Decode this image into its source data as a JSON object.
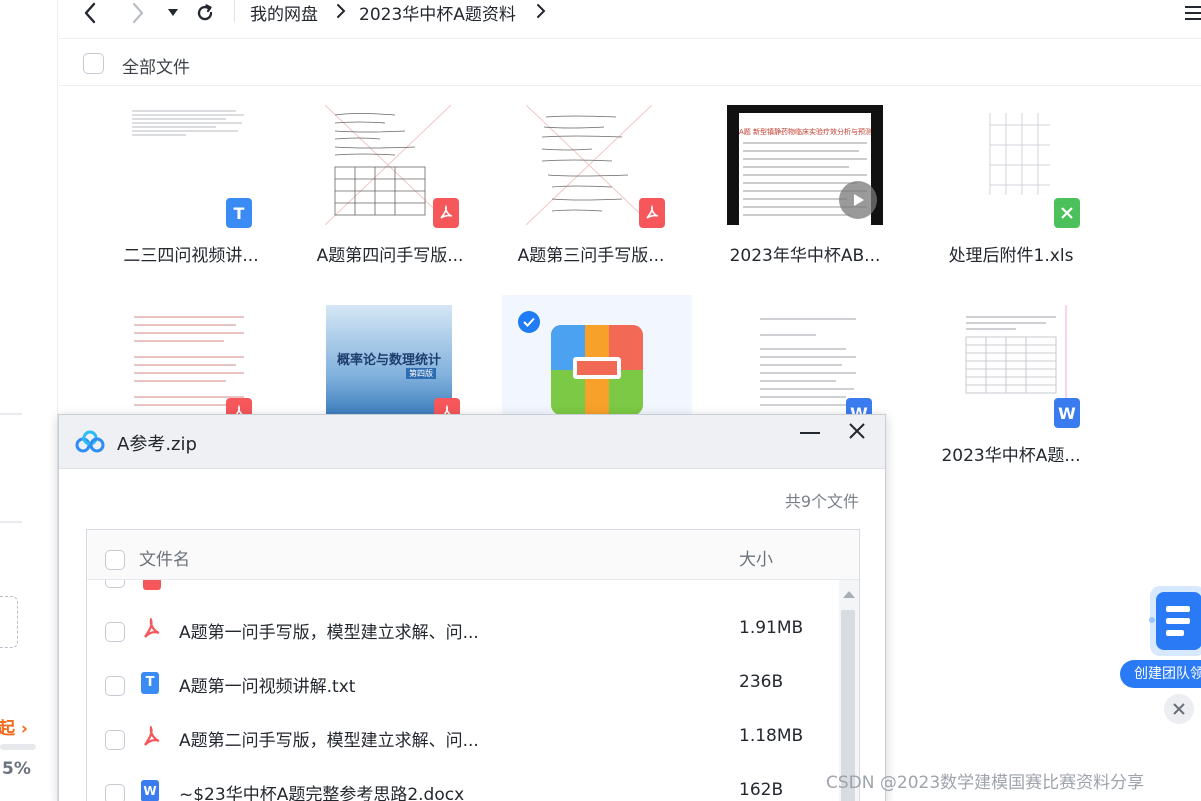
{
  "nav": {
    "crumbs": [
      "我的网盘",
      "2023华中杯A题资料"
    ]
  },
  "toolbar": {
    "all_files": "全部文件"
  },
  "grid": {
    "row1": [
      {
        "name": "二三四问视频讲...",
        "badge": "T"
      },
      {
        "name": "A题第四问手写版...",
        "badge": "pdf"
      },
      {
        "name": "A题第三问手写版...",
        "badge": "pdf"
      },
      {
        "name": "2023年华中杯AB...",
        "badge": "video",
        "thumb_title": "A题 新型镇静药物临床实验疗效分析与预测"
      },
      {
        "name": "处理后附件1.xls",
        "badge": "X"
      }
    ],
    "row2": [
      {
        "name": "",
        "badge": "pdf"
      },
      {
        "name": "",
        "badge": "pdf",
        "thumb_title": "概率论与数理统计",
        "thumb_sub": "第四版"
      },
      {
        "name": "",
        "badge": "zip",
        "selected": true
      },
      {
        "name": "",
        "badge": "W"
      },
      {
        "name": "2023华中杯A题...",
        "badge": "W"
      }
    ]
  },
  "sidebar": {
    "up_label": "起",
    "pct_label": "5%"
  },
  "modal": {
    "title": "A参考.zip",
    "count": "共9个文件",
    "col_name": "文件名",
    "col_size": "大小",
    "rows": [
      {
        "name": "A题第一问手写版，模型建立求解、问...",
        "size": "1.91MB",
        "type": "pdf"
      },
      {
        "name": "A题第一问视频讲解.txt",
        "size": "236B",
        "type": "txt"
      },
      {
        "name": "A题第二问手写版，模型建立求解、问...",
        "size": "1.18MB",
        "type": "pdf"
      },
      {
        "name": "~$23华中杯A题完整参考思路2.docx",
        "size": "162B",
        "type": "doc"
      }
    ]
  },
  "promo": {
    "label": "创建团队领福"
  },
  "watermark": "CSDN @2023数学建模国赛比赛资料分享"
}
